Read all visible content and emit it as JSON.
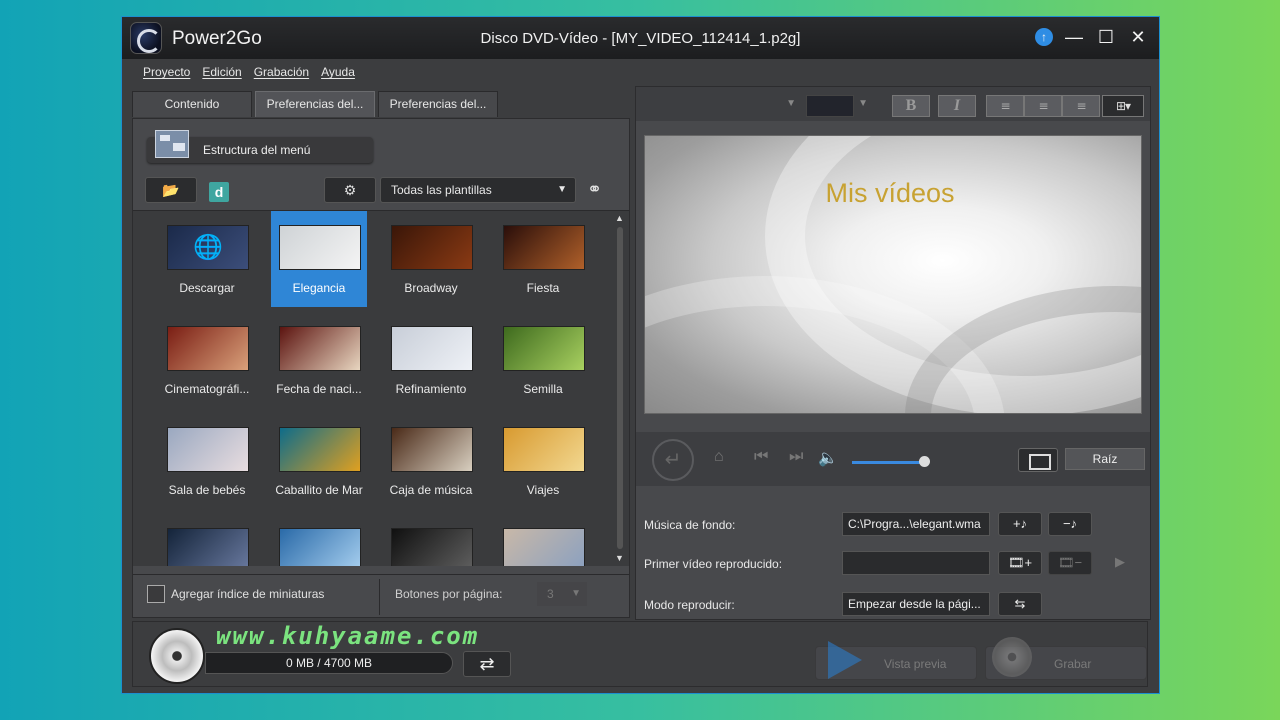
{
  "window": {
    "app_name": "Power2Go",
    "title": "Disco DVD-Vídeo - [MY_VIDEO_112414_1.p2g]",
    "controls": {
      "update": "↑",
      "minimize": "—",
      "maximize": "☐",
      "close": "✕"
    }
  },
  "menu": [
    "Proyecto",
    "Edición",
    "Grabación",
    "Ayuda"
  ],
  "tabs": [
    "Contenido",
    "Preferencias del...",
    "Preferencias del..."
  ],
  "active_tab": 1,
  "structure_button": "Estructura del menú",
  "template_filter": {
    "selected": "Todas las plantillas"
  },
  "templates": [
    {
      "label": "Descargar",
      "icon": "download-icon",
      "colors": [
        "#1b2a4a",
        "#3c4e7a"
      ]
    },
    {
      "label": "Elegancia",
      "selected": true,
      "colors": [
        "#cfd3d6",
        "#f4f4f4"
      ]
    },
    {
      "label": "Broadway",
      "colors": [
        "#3a1608",
        "#8a3a14"
      ]
    },
    {
      "label": "Fiesta",
      "colors": [
        "#2a0e0a",
        "#b0602a"
      ]
    },
    {
      "label": "Cinematográfi...",
      "colors": [
        "#7a1e14",
        "#d9a07a"
      ]
    },
    {
      "label": "Fecha de naci...",
      "colors": [
        "#5c1410",
        "#e8d6c0"
      ]
    },
    {
      "label": "Refinamiento",
      "colors": [
        "#c8ced8",
        "#eef1f6"
      ]
    },
    {
      "label": "Semilla",
      "colors": [
        "#3e6a1e",
        "#a8d060"
      ]
    },
    {
      "label": "Sala de bebés",
      "colors": [
        "#9aa8c0",
        "#e8dde0"
      ]
    },
    {
      "label": "Caballito de Mar",
      "colors": [
        "#0e6c8a",
        "#e0a020"
      ]
    },
    {
      "label": "Caja de música",
      "colors": [
        "#4a2a18",
        "#d8cfc0"
      ]
    },
    {
      "label": "Viajes",
      "colors": [
        "#d89a30",
        "#f2d890"
      ]
    },
    {
      "label": "",
      "colors": [
        "#14243a",
        "#6a7aa0"
      ]
    },
    {
      "label": "",
      "colors": [
        "#2a6aa8",
        "#a8d0f0"
      ]
    },
    {
      "label": "",
      "colors": [
        "#101010",
        "#606060"
      ]
    },
    {
      "label": "",
      "colors": [
        "#c8b8a8",
        "#8aa0c0"
      ]
    }
  ],
  "footer": {
    "thumbnail_index_label": "Agregar índice de miniaturas",
    "buttons_per_page_label": "Botones por página:",
    "buttons_per_page_value": "3"
  },
  "preview": {
    "title": "Mis vídeos"
  },
  "player": {
    "root_button": "Raíz",
    "volume": 0.82
  },
  "properties": {
    "background_music_label": "Música de fondo:",
    "background_music_value": "C:\\Progra...\\elegant.wma",
    "first_video_label": "Primer vídeo reproducido:",
    "first_video_value": "",
    "play_mode_label": "Modo reproducir:",
    "play_mode_value": "Empezar desde la pági..."
  },
  "bottom": {
    "capacity": "0 MB / 4700 MB",
    "watermark": "www.kuhyaame.com",
    "preview_button": "Vista previa",
    "burn_button": "Grabar"
  }
}
